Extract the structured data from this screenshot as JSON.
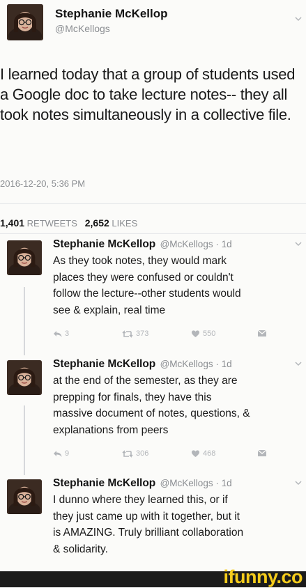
{
  "main_tweet": {
    "name": "Stephanie McKellop",
    "handle": "@McKellogs",
    "text": "I learned today that a group of students used a Google doc to take lecture notes-- they all took notes simultaneously in a collective file.",
    "timestamp": "2016-12-20, 5:36 PM",
    "retweets_count": "1,401",
    "retweets_label": "RETWEETS",
    "likes_count": "2,652",
    "likes_label": "LIKES"
  },
  "replies": [
    {
      "name": "Stephanie McKellop",
      "meta": "@McKellogs · 1d",
      "text": "As they took notes, they would mark\nplaces they were confused or couldn't\nfollow the lecture--other students would\nsee & explain, real time",
      "reply_count": "3",
      "retweet_count": "373",
      "like_count": "550"
    },
    {
      "name": "Stephanie McKellop",
      "meta": "@McKellogs · 1d",
      "text": "at the end of the semester, as they are\nprepping for finals, they have this\nmassive document of notes, questions, &\nexplanations from peers",
      "reply_count": "9",
      "retweet_count": "306",
      "like_count": "468"
    },
    {
      "name": "Stephanie McKellop",
      "meta": "@McKellogs · 1d",
      "text": "I dunno where they learned this, or if\nthey just came up with it together, but it\nis AMAZING. Truly brilliant collaboration\n& solidarity."
    }
  ],
  "watermark": "ifunny.co",
  "colors": {
    "text": "#1a1a1a",
    "muted": "#8a8d91",
    "icon": "#b3b6ba",
    "brand": "#f5cc1c",
    "bar": "#1c1c1c"
  },
  "icons": [
    "caret-down-icon",
    "reply-icon",
    "retweet-icon",
    "heart-icon",
    "direct-message-icon"
  ]
}
